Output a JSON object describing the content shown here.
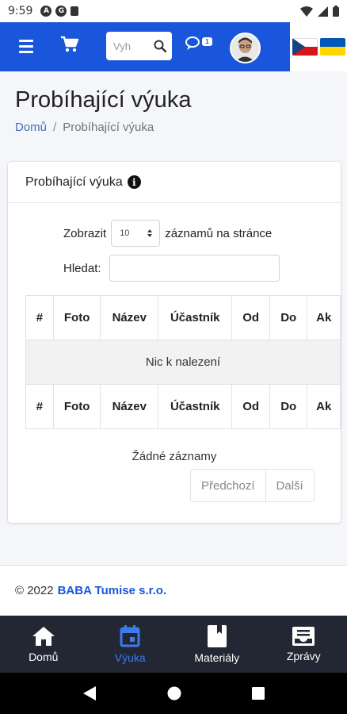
{
  "status_bar": {
    "time": "9:59",
    "notif_a": "A",
    "notif_b": "G"
  },
  "navbar": {
    "search_placeholder": "Vyh",
    "chat_badge": "1"
  },
  "page": {
    "title": "Probíhající výuka"
  },
  "breadcrumb": {
    "home": "Domů",
    "separator": "/",
    "current": "Probíhající výuka"
  },
  "card": {
    "title": "Probíhající výuka",
    "length": {
      "prefix": "Zobrazit",
      "value": "10",
      "suffix": "záznamů na stránce"
    },
    "search_label": "Hledat:",
    "columns": [
      "#",
      "Foto",
      "Název",
      "Účastník",
      "Od",
      "Do",
      "Ak"
    ],
    "empty_message": "Nic k nalezení",
    "info": "Žádné záznamy",
    "prev": "Předchozí",
    "next": "Další"
  },
  "footer": {
    "copy": "© 2022",
    "company": "BABA Tumise s.r.o."
  },
  "bottom_nav": [
    {
      "label": "Domů",
      "icon": "home-icon",
      "active": false
    },
    {
      "label": "Výuka",
      "icon": "calendar-icon",
      "active": true
    },
    {
      "label": "Materiály",
      "icon": "book-icon",
      "active": false
    },
    {
      "label": "Zprávy",
      "icon": "inbox-icon",
      "active": false
    }
  ],
  "colors": {
    "primary": "#1a56db",
    "active_tab": "#3b7bf0",
    "bottom_bar": "#232733"
  }
}
